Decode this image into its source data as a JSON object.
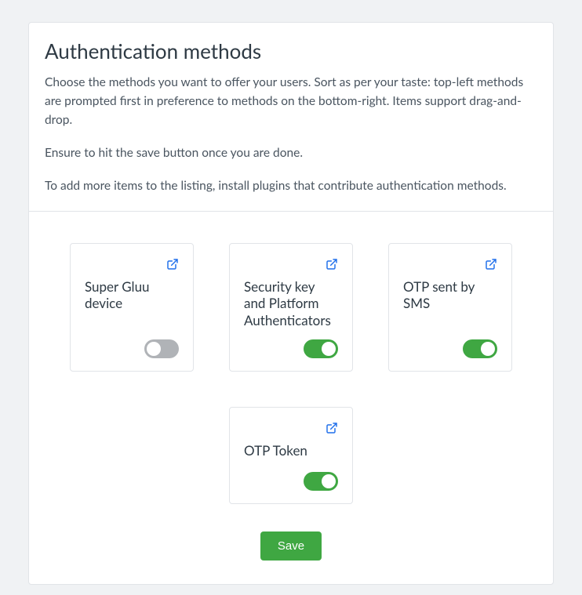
{
  "header": {
    "title": "Authentication methods",
    "desc1": "Choose the methods you want to offer your users. Sort as per your taste: top-left methods are prompted first in preference to methods on the bottom-right. Items support drag-and-drop.",
    "desc2": "Ensure to hit the save button once you are done.",
    "desc3": "To add more items to the listing, install plugins that contribute authentication methods."
  },
  "methods": [
    {
      "label": "Super Gluu device",
      "enabled": false
    },
    {
      "label": "Security key and Platform Authenticators",
      "enabled": true
    },
    {
      "label": "OTP sent by SMS",
      "enabled": true
    },
    {
      "label": "OTP Token",
      "enabled": true
    }
  ],
  "actions": {
    "save_label": "Save"
  },
  "colors": {
    "accent_green": "#3fa742",
    "link_blue": "#1f6feb",
    "toggle_off": "#b0b3b7"
  }
}
